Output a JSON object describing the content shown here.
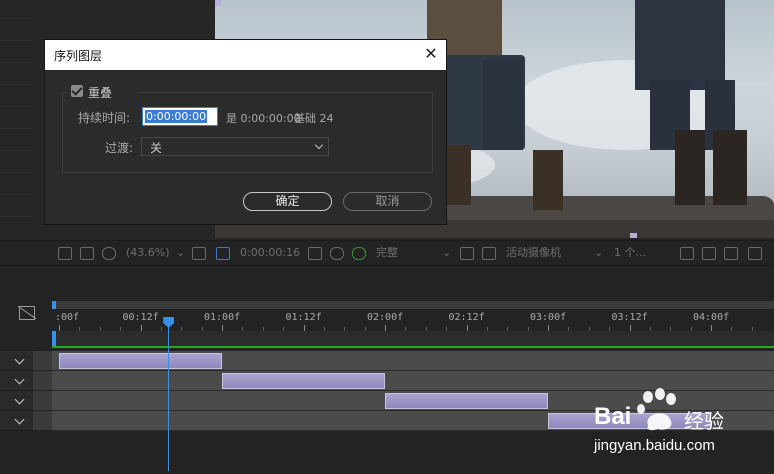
{
  "dialog": {
    "title": "序列图层",
    "overlap_label": "重叠",
    "overlap_checked": true,
    "duration_label": "持续时间:",
    "duration_value": "0:00:00:00",
    "is_text": "是 0:00:00:00",
    "base_text": "基础 24",
    "transition_label": "过渡:",
    "transition_value": "关",
    "ok_label": "确定",
    "cancel_label": "取消"
  },
  "viewer_toolbar": {
    "zoom": "(43.6%)",
    "timecode": "0:00:00:16",
    "resolution": "完整",
    "camera": "活动摄像机",
    "views": "1 个..."
  },
  "timeline": {
    "ruler_labels": [
      ":00f",
      "00:12f",
      "01:00f",
      "01:12f",
      "02:00f",
      "02:12f",
      "03:00f",
      "03:12f",
      "04:00f"
    ],
    "clips": [
      {
        "start": 0,
        "end": 1
      },
      {
        "start": 1,
        "end": 2
      },
      {
        "start": 2,
        "end": 3
      },
      {
        "start": 3,
        "end": 4
      }
    ],
    "playhead_seconds": 0.67
  },
  "watermark": {
    "brand": "Bai",
    "brand_suffix": "经验",
    "url": "jingyan.baidu.com"
  },
  "colors": {
    "accent": "#3a8ee6",
    "clip": "#9a94c6",
    "workarea_line": "#2aa52a",
    "selection": "#3a7bd5"
  }
}
